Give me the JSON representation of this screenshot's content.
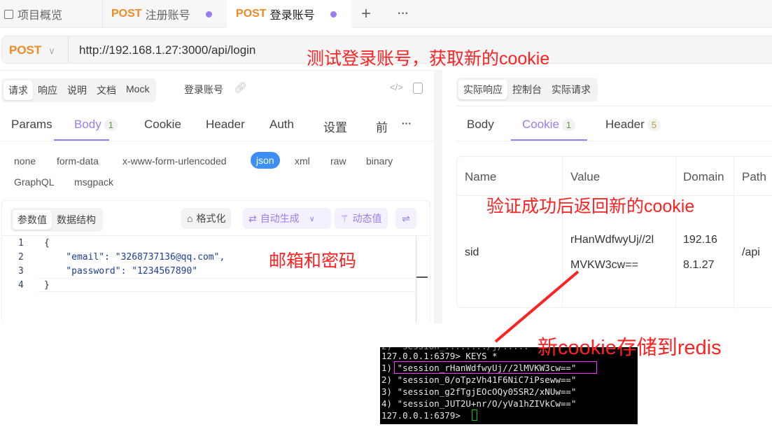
{
  "tabs": {
    "overview": "项目概览",
    "tab1": {
      "method": "POST",
      "name": "注册账号"
    },
    "tab2": {
      "method": "POST",
      "name": "登录账号"
    },
    "add": "+",
    "more": "···"
  },
  "url": {
    "method": "POST",
    "value": "http://192.168.1.27:3000/api/login"
  },
  "left": {
    "seg": [
      "请求",
      "响应",
      "说明",
      "文档",
      "Mock"
    ],
    "api_name": "登录账号",
    "tabs": [
      {
        "label": "Params"
      },
      {
        "label": "Body",
        "badge": "1"
      },
      {
        "label": "Cookie"
      },
      {
        "label": "Header"
      },
      {
        "label": "Auth"
      },
      {
        "label": "设置"
      },
      {
        "label": "前"
      }
    ],
    "more": "···",
    "body_types": [
      "none",
      "form-data",
      "x-www-form-urlencoded",
      "json",
      "xml",
      "raw",
      "binary",
      "GraphQL",
      "msgpack"
    ],
    "editor_seg": [
      "参数值",
      "数据结构"
    ],
    "format": "格式化",
    "autogen": "自动生成",
    "dynamic": "动态值",
    "code": [
      "{",
      "    \"email\": \"3268737136@qq.com\",",
      "    \"password\": \"1234567890\"",
      "}"
    ]
  },
  "right": {
    "seg": [
      "实际响应",
      "控制台",
      "实际请求"
    ],
    "tabs": [
      {
        "label": "Body"
      },
      {
        "label": "Cookie",
        "badge": "1"
      },
      {
        "label": "Header",
        "badge": "5"
      }
    ],
    "columns": [
      "Name",
      "Value",
      "Domain",
      "Path"
    ],
    "row": {
      "name": "sid",
      "value1": "rHanWdfwyUj//2l",
      "value2": "MVKW3cw==",
      "domain1": "192.16",
      "domain2": "8.1.27",
      "path": "/api"
    }
  },
  "annotations": {
    "a1": "测试登录账号，获取新的cookie",
    "a2": "验证成功后返回新的cookie",
    "a3": "邮箱和密码",
    "a4": "新cookie存储到redis"
  },
  "terminal": [
    "127.0.0.1:6379> KEYS *",
    "1) \"session_rHanWdfwyUj//2lMVKW3cw==\"",
    "2) \"session_0/oTpzVh41F6NiC7iPseww==\"",
    "3) \"session_g2fTgjEOcOQy05SR2/xNUw==\"",
    "4) \"session_JUT2U+nr/O/yVa1hZIVkCw==\"",
    "127.0.0.1:6379> "
  ],
  "colors": {
    "accent": "#9b7cf0",
    "post": "#f08a24",
    "annotation": "#ff2222",
    "json_chip": "#3b8ff6",
    "highlight": "#ff33ff"
  }
}
